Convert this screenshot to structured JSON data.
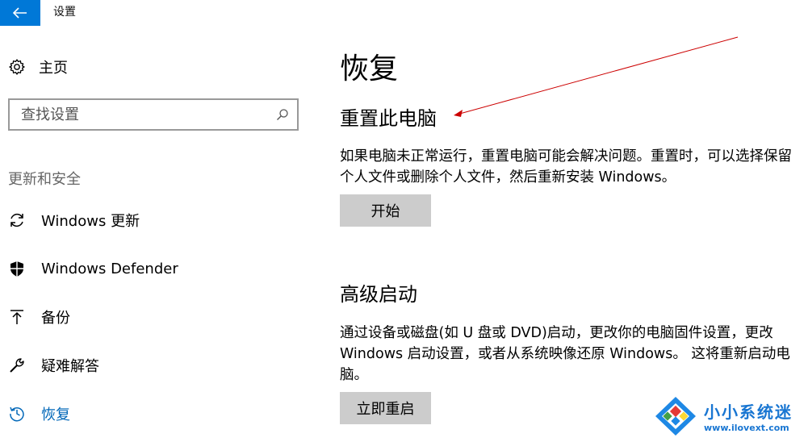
{
  "window": {
    "title": "设置"
  },
  "sidebar": {
    "home_label": "主页",
    "search_placeholder": "查找设置",
    "section_title": "更新和安全",
    "items": [
      {
        "label": "Windows 更新",
        "icon": "sync-icon"
      },
      {
        "label": "Windows Defender",
        "icon": "shield-icon"
      },
      {
        "label": "备份",
        "icon": "backup-arrow-icon"
      },
      {
        "label": "疑难解答",
        "icon": "wrench-icon"
      },
      {
        "label": "恢复",
        "icon": "history-icon",
        "active": true
      }
    ]
  },
  "main": {
    "title": "恢复",
    "reset": {
      "heading": "重置此电脑",
      "description": "如果电脑未正常运行，重置电脑可能会解决问题。重置时，可以选择保留个人文件或删除个人文件，然后重新安装 Windows。",
      "button": "开始"
    },
    "advanced": {
      "heading": "高级启动",
      "description": "通过设备或磁盘(如 U 盘或 DVD)启动，更改你的电脑固件设置，更改 Windows 启动设置，或者从系统映像还原 Windows。 这将重新启动电脑。",
      "button": "立即重启"
    }
  },
  "watermark": {
    "title": "小小系统迷",
    "url": "www.ilovext.com"
  },
  "colors": {
    "accent": "#0078d7",
    "link": "#0067b8",
    "button_bg": "#cccccc",
    "annotation": "#cc0000",
    "watermark": "#1976d2"
  }
}
